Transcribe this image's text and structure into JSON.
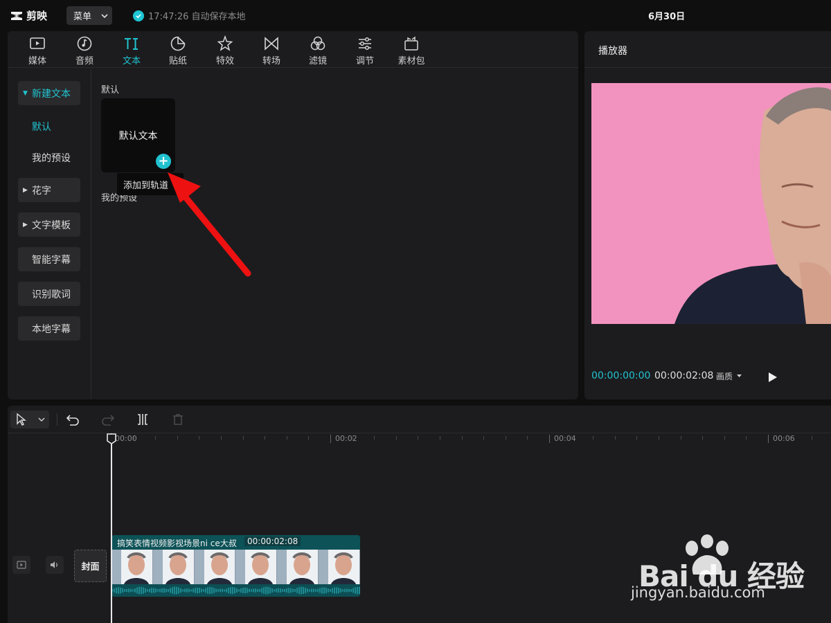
{
  "app": {
    "logo_text": "剪映",
    "menu_label": "菜单",
    "save_status": "17:47:26 自动保存本地",
    "project_title": "6月30日"
  },
  "toolbar": {
    "tabs": [
      {
        "label": "媒体",
        "icon": "media-icon"
      },
      {
        "label": "音频",
        "icon": "audio-icon"
      },
      {
        "label": "文本",
        "icon": "text-icon",
        "active": true
      },
      {
        "label": "贴纸",
        "icon": "sticker-icon"
      },
      {
        "label": "特效",
        "icon": "effects-icon"
      },
      {
        "label": "转场",
        "icon": "transition-icon"
      },
      {
        "label": "滤镜",
        "icon": "filter-icon"
      },
      {
        "label": "调节",
        "icon": "adjust-icon"
      },
      {
        "label": "素材包",
        "icon": "material-pack-icon"
      }
    ]
  },
  "sidebar": {
    "new_text": "新建文本",
    "sub_default": "默认",
    "sub_my_presets": "我的预设",
    "fancy_text": "花字",
    "text_templates": "文字模板",
    "smart_subtitles": "智能字幕",
    "lyrics": "识别歌词",
    "local_subtitles": "本地字幕"
  },
  "content": {
    "section_default": "默认",
    "card_label": "默认文本",
    "add_symbol": "+",
    "tooltip": "添加到轨道",
    "section_my_presets": "我的预设"
  },
  "player": {
    "title": "播放器",
    "current_time": "00:00:00:00",
    "total_time": "00:00:02:08",
    "quality_label": "画质"
  },
  "timeline": {
    "ruler": [
      "00:00",
      "00:02",
      "00:04",
      "00:06"
    ],
    "cover_label": "封面",
    "clip_name": "搞笑表情视频影视场景ni ce大叔",
    "clip_duration": "00:00:02:08"
  },
  "watermark": {
    "brand": "Bai du 经验",
    "url": "jingyan.baidu.com"
  },
  "colors": {
    "accent": "#21c3d0",
    "panel": "#1c1c1e",
    "background": "#0f0f10",
    "video_bg": "#f293bf",
    "clip": "#0c5257",
    "annotation_arrow": "#ee1111"
  }
}
